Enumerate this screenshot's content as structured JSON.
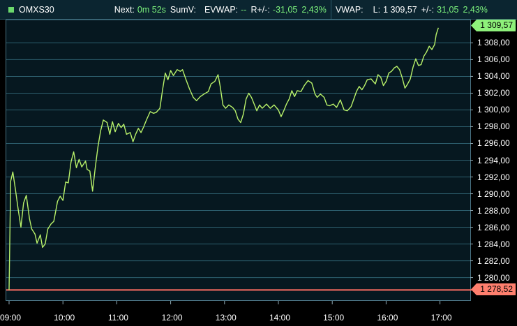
{
  "header": {
    "symbol": "OMXS30",
    "next_label": "Next:",
    "next_value": "0m 52s",
    "sumv_label": "SumV:",
    "evwap_label": "EVWAP:",
    "evwap_value": "--",
    "rplus_label": "R+/-:",
    "rplus_value": "-31,05",
    "rplus_pct": "2,43%",
    "vwap_label": "VWAP:",
    "last_label": "L:",
    "last_value": "1 309,57",
    "change_label": "+/-:",
    "change_value": "31,05",
    "change_pct": "2,43%"
  },
  "colors": {
    "line": "#b9f26a",
    "prev_close_line": "#ff6e63",
    "grid": "#2d5f6e",
    "last_tag": "#8ef07a",
    "prev_tag": "#ff7f6e"
  },
  "chart_data": {
    "type": "line",
    "y_ticks": [
      "1 280,00",
      "1 282,00",
      "1 284,00",
      "1 286,00",
      "1 288,00",
      "1 290,00",
      "1 292,00",
      "1 294,00",
      "1 296,00",
      "1 298,00",
      "1 300,00",
      "1 302,00",
      "1 304,00",
      "1 306,00",
      "1 308,00"
    ],
    "x_ticks": [
      "09:00",
      "10:00",
      "11:00",
      "12:00",
      "13:00",
      "14:00",
      "15:00",
      "16:00",
      "17:00"
    ],
    "ylim": [
      1277.3,
      1310.7
    ],
    "last_price": "1 309,57",
    "prev_close": "1 278,52",
    "prev_close_value": 1278.52,
    "series_points": [
      [
        9.0,
        1278.5
      ],
      [
        9.03,
        1291.5
      ],
      [
        9.07,
        1292.6
      ],
      [
        9.12,
        1290.4
      ],
      [
        9.17,
        1288.1
      ],
      [
        9.22,
        1286.0
      ],
      [
        9.27,
        1288.9
      ],
      [
        9.32,
        1289.8
      ],
      [
        9.38,
        1287.0
      ],
      [
        9.42,
        1285.8
      ],
      [
        9.48,
        1285.2
      ],
      [
        9.52,
        1284.1
      ],
      [
        9.58,
        1285.1
      ],
      [
        9.62,
        1283.6
      ],
      [
        9.67,
        1284.0
      ],
      [
        9.72,
        1285.8
      ],
      [
        9.78,
        1286.4
      ],
      [
        9.83,
        1286.7
      ],
      [
        9.9,
        1289.1
      ],
      [
        9.95,
        1289.7
      ],
      [
        10.0,
        1289.2
      ],
      [
        10.05,
        1291.4
      ],
      [
        10.1,
        1291.3
      ],
      [
        10.15,
        1293.8
      ],
      [
        10.2,
        1295.0
      ],
      [
        10.25,
        1293.1
      ],
      [
        10.3,
        1294.1
      ],
      [
        10.35,
        1293.2
      ],
      [
        10.42,
        1293.9
      ],
      [
        10.45,
        1292.9
      ],
      [
        10.5,
        1292.7
      ],
      [
        10.55,
        1290.3
      ],
      [
        10.6,
        1293.1
      ],
      [
        10.65,
        1295.6
      ],
      [
        10.7,
        1297.5
      ],
      [
        10.75,
        1298.8
      ],
      [
        10.82,
        1298.5
      ],
      [
        10.87,
        1297.1
      ],
      [
        10.92,
        1298.6
      ],
      [
        10.97,
        1297.4
      ],
      [
        11.03,
        1298.4
      ],
      [
        11.08,
        1297.9
      ],
      [
        11.13,
        1298.3
      ],
      [
        11.18,
        1297.1
      ],
      [
        11.25,
        1297.3
      ],
      [
        11.3,
        1296.2
      ],
      [
        11.35,
        1297.1
      ],
      [
        11.4,
        1297.8
      ],
      [
        11.45,
        1297.3
      ],
      [
        11.5,
        1298.0
      ],
      [
        11.55,
        1298.8
      ],
      [
        11.62,
        1299.8
      ],
      [
        11.68,
        1299.6
      ],
      [
        11.73,
        1299.7
      ],
      [
        11.8,
        1300.2
      ],
      [
        11.85,
        1302.4
      ],
      [
        11.9,
        1304.4
      ],
      [
        11.95,
        1303.6
      ],
      [
        12.0,
        1304.7
      ],
      [
        12.05,
        1304.1
      ],
      [
        12.12,
        1304.8
      ],
      [
        12.18,
        1304.6
      ],
      [
        12.22,
        1304.8
      ],
      [
        12.28,
        1303.7
      ],
      [
        12.35,
        1302.5
      ],
      [
        12.42,
        1301.5
      ],
      [
        12.48,
        1301.1
      ],
      [
        12.55,
        1301.6
      ],
      [
        12.62,
        1301.9
      ],
      [
        12.7,
        1302.2
      ],
      [
        12.75,
        1303.1
      ],
      [
        12.82,
        1303.4
      ],
      [
        12.88,
        1304.2
      ],
      [
        12.92,
        1302.8
      ],
      [
        12.97,
        1300.6
      ],
      [
        13.02,
        1300.2
      ],
      [
        13.08,
        1300.6
      ],
      [
        13.15,
        1300.3
      ],
      [
        13.2,
        1299.9
      ],
      [
        13.25,
        1298.9
      ],
      [
        13.3,
        1298.5
      ],
      [
        13.35,
        1299.5
      ],
      [
        13.4,
        1301.3
      ],
      [
        13.45,
        1302.0
      ],
      [
        13.5,
        1301.5
      ],
      [
        13.55,
        1300.7
      ],
      [
        13.6,
        1299.9
      ],
      [
        13.65,
        1300.6
      ],
      [
        13.7,
        1300.2
      ],
      [
        13.78,
        1300.7
      ],
      [
        13.85,
        1300.2
      ],
      [
        13.92,
        1300.6
      ],
      [
        14.0,
        1300.0
      ],
      [
        14.05,
        1299.2
      ],
      [
        14.1,
        1299.9
      ],
      [
        14.15,
        1300.7
      ],
      [
        14.2,
        1301.3
      ],
      [
        14.25,
        1302.3
      ],
      [
        14.3,
        1301.6
      ],
      [
        14.35,
        1302.3
      ],
      [
        14.42,
        1302.2
      ],
      [
        14.48,
        1302.9
      ],
      [
        14.55,
        1303.5
      ],
      [
        14.62,
        1303.2
      ],
      [
        14.68,
        1301.9
      ],
      [
        14.72,
        1301.5
      ],
      [
        14.78,
        1301.9
      ],
      [
        14.85,
        1301.5
      ],
      [
        14.9,
        1300.6
      ],
      [
        14.95,
        1300.5
      ],
      [
        15.02,
        1300.7
      ],
      [
        15.08,
        1300.3
      ],
      [
        15.15,
        1301.2
      ],
      [
        15.22,
        1300.0
      ],
      [
        15.28,
        1299.9
      ],
      [
        15.35,
        1300.4
      ],
      [
        15.4,
        1301.3
      ],
      [
        15.45,
        1302.2
      ],
      [
        15.5,
        1302.8
      ],
      [
        15.55,
        1302.4
      ],
      [
        15.6,
        1302.9
      ],
      [
        15.65,
        1303.6
      ],
      [
        15.72,
        1303.7
      ],
      [
        15.8,
        1303.1
      ],
      [
        15.85,
        1304.2
      ],
      [
        15.9,
        1303.9
      ],
      [
        15.95,
        1302.9
      ],
      [
        16.0,
        1303.4
      ],
      [
        16.05,
        1304.4
      ],
      [
        16.1,
        1304.6
      ],
      [
        16.15,
        1305.0
      ],
      [
        16.2,
        1305.2
      ],
      [
        16.25,
        1304.8
      ],
      [
        16.3,
        1303.8
      ],
      [
        16.35,
        1302.6
      ],
      [
        16.4,
        1303.1
      ],
      [
        16.45,
        1303.7
      ],
      [
        16.5,
        1305.1
      ],
      [
        16.55,
        1306.1
      ],
      [
        16.6,
        1305.3
      ],
      [
        16.65,
        1305.4
      ],
      [
        16.7,
        1306.4
      ],
      [
        16.75,
        1306.9
      ],
      [
        16.8,
        1307.6
      ],
      [
        16.85,
        1307.2
      ],
      [
        16.9,
        1307.8
      ],
      [
        16.93,
        1309.0
      ],
      [
        16.97,
        1309.8
      ]
    ]
  }
}
